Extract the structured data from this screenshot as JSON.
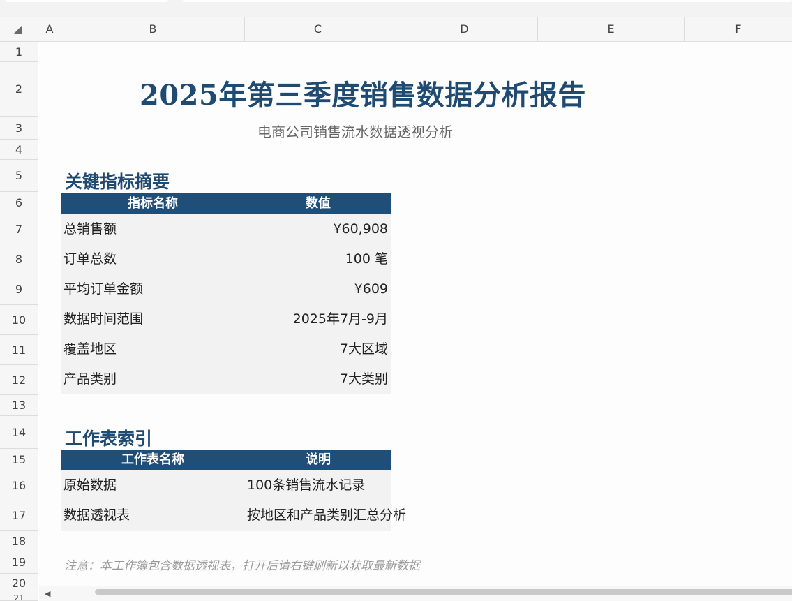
{
  "columns": [
    "A",
    "B",
    "C",
    "D",
    "E",
    "F"
  ],
  "rows": [
    "1",
    "2",
    "3",
    "4",
    "5",
    "6",
    "7",
    "8",
    "9",
    "10",
    "11",
    "12",
    "13",
    "14",
    "15",
    "16",
    "17",
    "18",
    "19",
    "20",
    "21"
  ],
  "title": "2025年第三季度销售数据分析报告",
  "subtitle": "电商公司销售流水数据透视分析",
  "summary": {
    "heading": "关键指标摘要",
    "col1": "指标名称",
    "col2": "数值",
    "rows": [
      {
        "name": "总销售额",
        "value": "¥60,908"
      },
      {
        "name": "订单总数",
        "value": "100 笔"
      },
      {
        "name": "平均订单金额",
        "value": "¥609"
      },
      {
        "name": "数据时间范围",
        "value": "2025年7月-9月"
      },
      {
        "name": "覆盖地区",
        "value": "7大区域"
      },
      {
        "name": "产品类别",
        "value": "7大类别"
      }
    ]
  },
  "index": {
    "heading": "工作表索引",
    "col1": "工作表名称",
    "col2": "说明",
    "rows": [
      {
        "name": "原始数据",
        "desc": "100条销售流水记录"
      },
      {
        "name": "数据透视表",
        "desc": "按地区和产品类别汇总分析"
      }
    ]
  },
  "note": "注意：本工作簿包含数据透视表，打开后请右键刷新以获取最新数据",
  "colors": {
    "accent": "#1f4a72",
    "header_fill": "#1f4e79",
    "body_fill": "#f2f2f2",
    "note": "#9a9a9a"
  }
}
